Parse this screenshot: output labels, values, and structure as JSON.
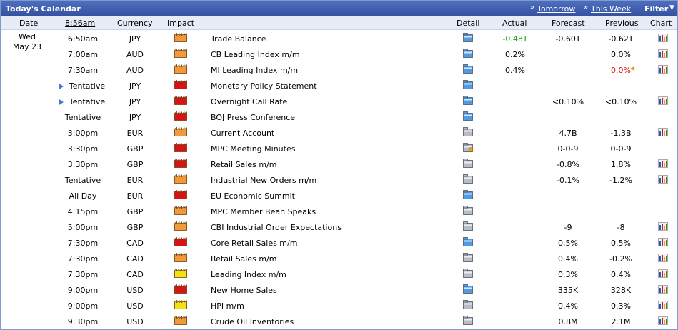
{
  "header": {
    "title": "Today's Calendar",
    "tomorrow": "Tomorrow",
    "this_week": "This Week",
    "filter": "Filter"
  },
  "columns": {
    "date": "Date",
    "time": "8:56am",
    "currency": "Currency",
    "impact": "Impact",
    "detail": "Detail",
    "actual": "Actual",
    "forecast": "Forecast",
    "previous": "Previous",
    "chart": "Chart"
  },
  "day": {
    "weekday": "Wed",
    "date": "May 23"
  },
  "colors": {
    "high": "#d81313",
    "medium": "#f29a3a",
    "low": "#f2e20f",
    "better_actual": "#1a9c1a",
    "revised": "#d81313"
  },
  "events": [
    {
      "time": "6:50am",
      "currency": "JPY",
      "impact": "medium",
      "event": "Trade Balance",
      "actual": "-0.48T",
      "actual_class": "green",
      "forecast": "-0.60T",
      "previous": "-0.62T",
      "previous_class": "",
      "detail": "blue",
      "chart": true,
      "bullet": false
    },
    {
      "time": "7:00am",
      "currency": "AUD",
      "impact": "medium",
      "event": "CB Leading Index m/m",
      "actual": "0.2%",
      "actual_class": "",
      "forecast": "",
      "previous": "0.0%",
      "previous_class": "",
      "detail": "blue",
      "chart": true,
      "bullet": false
    },
    {
      "time": "7:30am",
      "currency": "AUD",
      "impact": "medium",
      "event": "MI Leading Index m/m",
      "actual": "0.4%",
      "actual_class": "",
      "forecast": "",
      "previous": "0.0%",
      "previous_class": "red",
      "detail": "blue",
      "chart": true,
      "bullet": false,
      "revised": true
    },
    {
      "time": "Tentative",
      "currency": "JPY",
      "impact": "high",
      "event": "Monetary Policy Statement",
      "actual": "",
      "actual_class": "",
      "forecast": "",
      "previous": "",
      "previous_class": "",
      "detail": "blue",
      "chart": false,
      "bullet": true
    },
    {
      "time": "Tentative",
      "currency": "JPY",
      "impact": "high",
      "event": "Overnight Call Rate",
      "actual": "",
      "actual_class": "",
      "forecast": "<0.10%",
      "previous": "<0.10%",
      "previous_class": "",
      "detail": "blue",
      "chart": true,
      "bullet": true
    },
    {
      "time": "Tentative",
      "currency": "JPY",
      "impact": "high",
      "event": "BOJ Press Conference",
      "actual": "",
      "actual_class": "",
      "forecast": "",
      "previous": "",
      "previous_class": "",
      "detail": "blue",
      "chart": false,
      "bullet": false
    },
    {
      "time": "3:00pm",
      "currency": "EUR",
      "impact": "medium",
      "event": "Current Account",
      "actual": "",
      "actual_class": "",
      "forecast": "4.7B",
      "previous": "-1.3B",
      "previous_class": "",
      "detail": "gray",
      "chart": true,
      "bullet": false
    },
    {
      "time": "3:30pm",
      "currency": "GBP",
      "impact": "high",
      "event": "MPC Meeting Minutes",
      "actual": "",
      "actual_class": "",
      "forecast": "0-0-9",
      "previous": "0-0-9",
      "previous_class": "",
      "detail": "star",
      "chart": false,
      "bullet": false
    },
    {
      "time": "3:30pm",
      "currency": "GBP",
      "impact": "high",
      "event": "Retail Sales m/m",
      "actual": "",
      "actual_class": "",
      "forecast": "-0.8%",
      "previous": "1.8%",
      "previous_class": "",
      "detail": "gray",
      "chart": true,
      "bullet": false
    },
    {
      "time": "Tentative",
      "currency": "EUR",
      "impact": "medium",
      "event": "Industrial New Orders m/m",
      "actual": "",
      "actual_class": "",
      "forecast": "-0.1%",
      "previous": "-1.2%",
      "previous_class": "",
      "detail": "gray",
      "chart": true,
      "bullet": false
    },
    {
      "time": "All Day",
      "currency": "EUR",
      "impact": "high",
      "event": "EU Economic Summit",
      "actual": "",
      "actual_class": "",
      "forecast": "",
      "previous": "",
      "previous_class": "",
      "detail": "blue",
      "chart": false,
      "bullet": false
    },
    {
      "time": "4:15pm",
      "currency": "GBP",
      "impact": "medium",
      "event": "MPC Member Bean Speaks",
      "actual": "",
      "actual_class": "",
      "forecast": "",
      "previous": "",
      "previous_class": "",
      "detail": "gray",
      "chart": false,
      "bullet": false
    },
    {
      "time": "5:00pm",
      "currency": "GBP",
      "impact": "medium",
      "event": "CBI Industrial Order Expectations",
      "actual": "",
      "actual_class": "",
      "forecast": "-9",
      "previous": "-8",
      "previous_class": "",
      "detail": "gray",
      "chart": true,
      "bullet": false
    },
    {
      "time": "7:30pm",
      "currency": "CAD",
      "impact": "high",
      "event": "Core Retail Sales m/m",
      "actual": "",
      "actual_class": "",
      "forecast": "0.5%",
      "previous": "0.5%",
      "previous_class": "",
      "detail": "blue",
      "chart": true,
      "bullet": false
    },
    {
      "time": "7:30pm",
      "currency": "CAD",
      "impact": "medium",
      "event": "Retail Sales m/m",
      "actual": "",
      "actual_class": "",
      "forecast": "0.4%",
      "previous": "-0.2%",
      "previous_class": "",
      "detail": "gray",
      "chart": true,
      "bullet": false
    },
    {
      "time": "7:30pm",
      "currency": "CAD",
      "impact": "low",
      "event": "Leading Index m/m",
      "actual": "",
      "actual_class": "",
      "forecast": "0.3%",
      "previous": "0.4%",
      "previous_class": "",
      "detail": "gray",
      "chart": true,
      "bullet": false
    },
    {
      "time": "9:00pm",
      "currency": "USD",
      "impact": "high",
      "event": "New Home Sales",
      "actual": "",
      "actual_class": "",
      "forecast": "335K",
      "previous": "328K",
      "previous_class": "",
      "detail": "blue",
      "chart": true,
      "bullet": false
    },
    {
      "time": "9:00pm",
      "currency": "USD",
      "impact": "low",
      "event": "HPI m/m",
      "actual": "",
      "actual_class": "",
      "forecast": "0.4%",
      "previous": "0.3%",
      "previous_class": "",
      "detail": "gray",
      "chart": true,
      "bullet": false
    },
    {
      "time": "9:30pm",
      "currency": "USD",
      "impact": "medium",
      "event": "Crude Oil Inventories",
      "actual": "",
      "actual_class": "",
      "forecast": "0.8M",
      "previous": "2.1M",
      "previous_class": "",
      "detail": "gray",
      "chart": true,
      "bullet": false
    }
  ]
}
